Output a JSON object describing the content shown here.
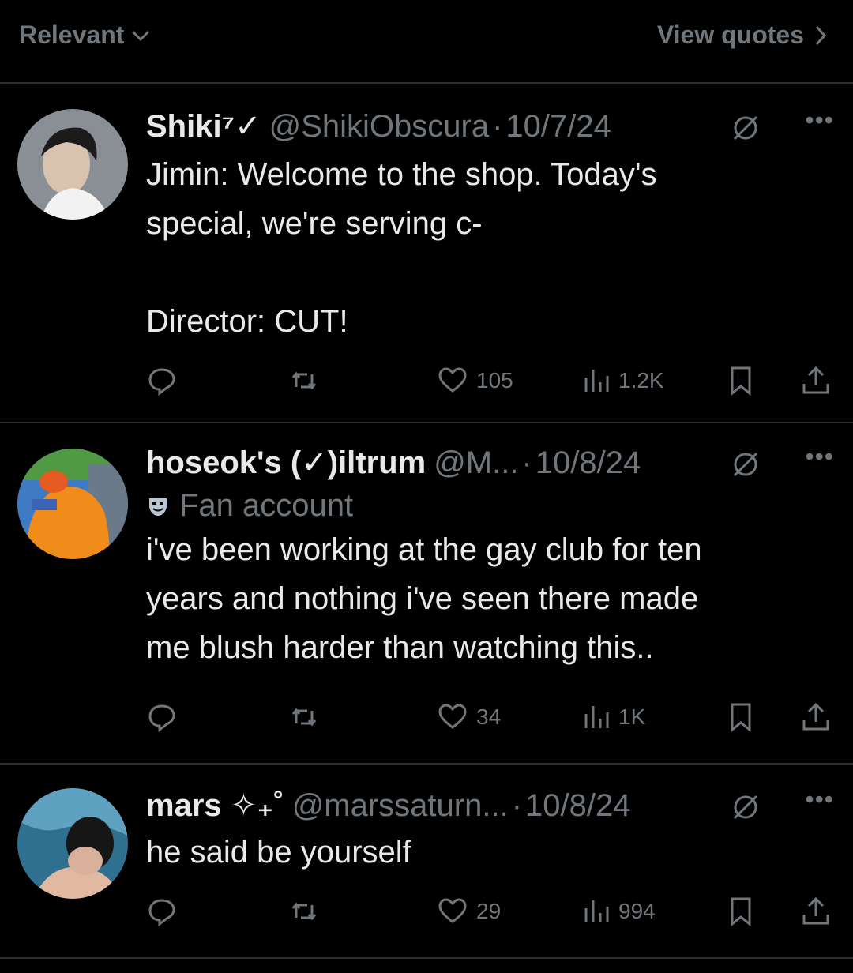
{
  "topbar": {
    "sort_label": "Relevant",
    "view_quotes_label": "View quotes"
  },
  "tweets": [
    {
      "name": "Shiki⁷✓",
      "handle": "@ShikiObscura",
      "date": "10/7/24",
      "text": "Jimin: Welcome to the shop. Today's\nspecial, we're serving c-\n\nDirector: CUT!",
      "likes": "105",
      "views": "1.2K"
    },
    {
      "name": "hoseok's (✓)iltrum",
      "handle": "@M...",
      "date": "10/8/24",
      "badge": "Fan account",
      "text": "i've been working at the gay club for ten\nyears and nothing i've seen there made\nme blush harder than watching this..",
      "likes": "34",
      "views": "1K"
    },
    {
      "name": "mars ✧₊˚",
      "handle": "@marssaturn...",
      "date": "10/8/24",
      "text": "he said be yourself",
      "likes": "29",
      "views": "994"
    }
  ],
  "colors": {
    "background": "#000000",
    "text": "#e7e9ea",
    "muted": "#71767b",
    "divider": "#2a2d31"
  }
}
